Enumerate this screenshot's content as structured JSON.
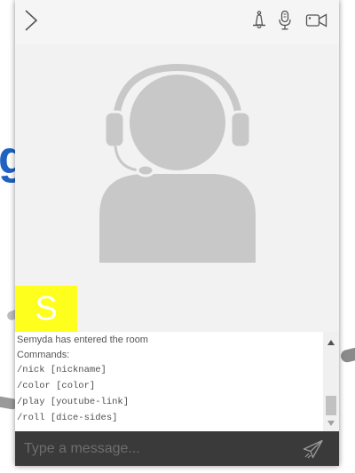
{
  "background": {
    "partial_heading_letter": "g"
  },
  "toolbar": {
    "collapse_icon": "chevron-right-icon",
    "bell_icon": "bell-icon",
    "mic_icon": "microphone-icon",
    "video_icon": "video-camera-icon"
  },
  "avatar": {
    "icon": "headset-user-icon",
    "color": "#c8c8c8"
  },
  "user_badge": {
    "initial": "S",
    "color": "#ffff1e"
  },
  "messages": [
    {
      "text": "Semyda has entered the room",
      "style": "sans"
    },
    {
      "text": "Commands:",
      "style": "sans"
    },
    {
      "text": "/nick [nickname]",
      "style": "mono"
    },
    {
      "text": "/color [color]",
      "style": "mono"
    },
    {
      "text": "/play [youtube-link]",
      "style": "mono"
    },
    {
      "text": "/roll [dice-sides]",
      "style": "mono"
    }
  ],
  "scrollbar": {
    "up_icon": "triangle-up-icon",
    "down_icon": "triangle-down-icon"
  },
  "composer": {
    "placeholder": "Type a message...",
    "value": "",
    "send_icon": "paper-plane-icon"
  }
}
